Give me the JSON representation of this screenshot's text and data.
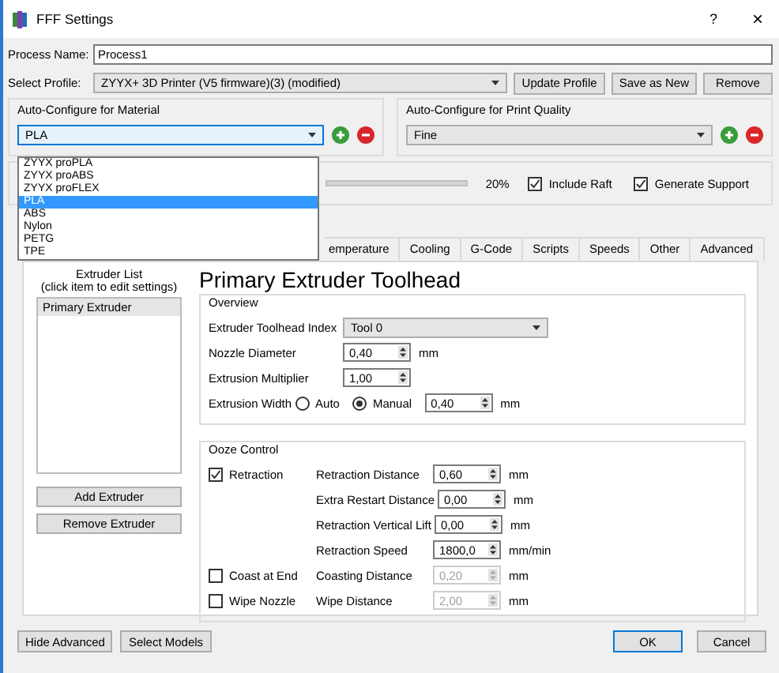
{
  "window": {
    "title": "FFF Settings",
    "help": "?",
    "close": "×"
  },
  "process_name": {
    "label": "Process Name:",
    "value": "Process1"
  },
  "profile": {
    "label": "Select Profile:",
    "value": "ZYYX+ 3D Printer (V5 firmware)(3) (modified)",
    "buttons": [
      "Update Profile",
      "Save as New",
      "Remove"
    ]
  },
  "material": {
    "title": "Auto-Configure for Material",
    "value": "PLA",
    "expanded": true,
    "options": [
      {
        "label": "ZYYX proPLA",
        "selected": false
      },
      {
        "label": "ZYYX proABS",
        "selected": false
      },
      {
        "label": "ZYYX proFLEX",
        "selected": false
      },
      {
        "label": "PLA",
        "selected": true
      },
      {
        "label": "ABS",
        "selected": false
      },
      {
        "label": "Nylon",
        "selected": false
      },
      {
        "label": "PETG",
        "selected": false
      },
      {
        "label": "TPE",
        "selected": false
      }
    ]
  },
  "quality": {
    "title": "Auto-Configure for Print Quality",
    "value": "Fine"
  },
  "print_settings": {
    "reading": "20%",
    "checks": [
      {
        "label": "Include Raft",
        "checked": true
      },
      {
        "label": "Generate Support",
        "checked": true
      }
    ]
  },
  "tabs": [
    {
      "label": "emperature",
      "selected": false
    },
    {
      "label": "Cooling",
      "selected": false
    },
    {
      "label": "G-Code",
      "selected": false
    },
    {
      "label": "Scripts",
      "selected": false
    },
    {
      "label": "Speeds",
      "selected": false
    },
    {
      "label": "Other",
      "selected": false
    },
    {
      "label": "Advanced",
      "selected": false
    }
  ],
  "extruder_list": {
    "title": "Extruder List",
    "hint": "(click item to edit settings)",
    "items": [
      {
        "label": "Primary Extruder",
        "selected": true
      }
    ],
    "buttons": [
      "Add Extruder",
      "Remove Extruder"
    ]
  },
  "heading": "Primary Extruder Toolhead",
  "overview": {
    "title": "Overview",
    "rows": [
      {
        "kind": "combo",
        "label": "Extruder Toolhead Index",
        "value": "Tool 0"
      },
      {
        "kind": "spin",
        "label": "Nozzle Diameter",
        "value": "0,40",
        "unit": "mm"
      },
      {
        "kind": "spin",
        "label": "Extrusion Multiplier",
        "value": "1,00"
      },
      {
        "kind": "radio",
        "label": "Extrusion Width",
        "options": [
          {
            "label": "Auto",
            "selected": false
          },
          {
            "label": "Manual",
            "selected": true
          }
        ],
        "value": "0,40",
        "unit": "mm"
      }
    ]
  },
  "ooze": {
    "title": "Ooze Control",
    "rows": [
      {
        "check": {
          "label": "Retraction",
          "checked": true
        },
        "label": "Retraction Distance",
        "value": "0,60",
        "unit": "mm",
        "disabled": false
      },
      {
        "label": "Extra Restart Distance",
        "value": "0,00",
        "unit": "mm",
        "disabled": false
      },
      {
        "label": "Retraction Vertical Lift",
        "value": "0,00",
        "unit": "mm",
        "disabled": false
      },
      {
        "label": "Retraction Speed",
        "value": "1800,0",
        "unit": "mm/min",
        "disabled": false
      },
      {
        "check": {
          "label": "Coast at End",
          "checked": false
        },
        "label": "Coasting Distance",
        "value": "0,20",
        "unit": "mm",
        "disabled": true
      },
      {
        "check": {
          "label": "Wipe Nozzle",
          "checked": false
        },
        "label": "Wipe Distance",
        "value": "2,00",
        "unit": "mm",
        "disabled": true
      }
    ]
  },
  "footer": {
    "left": [
      "Hide Advanced",
      "Select Models"
    ],
    "right": [
      {
        "label": "OK",
        "default": true
      },
      {
        "label": "Cancel",
        "default": false
      }
    ]
  }
}
